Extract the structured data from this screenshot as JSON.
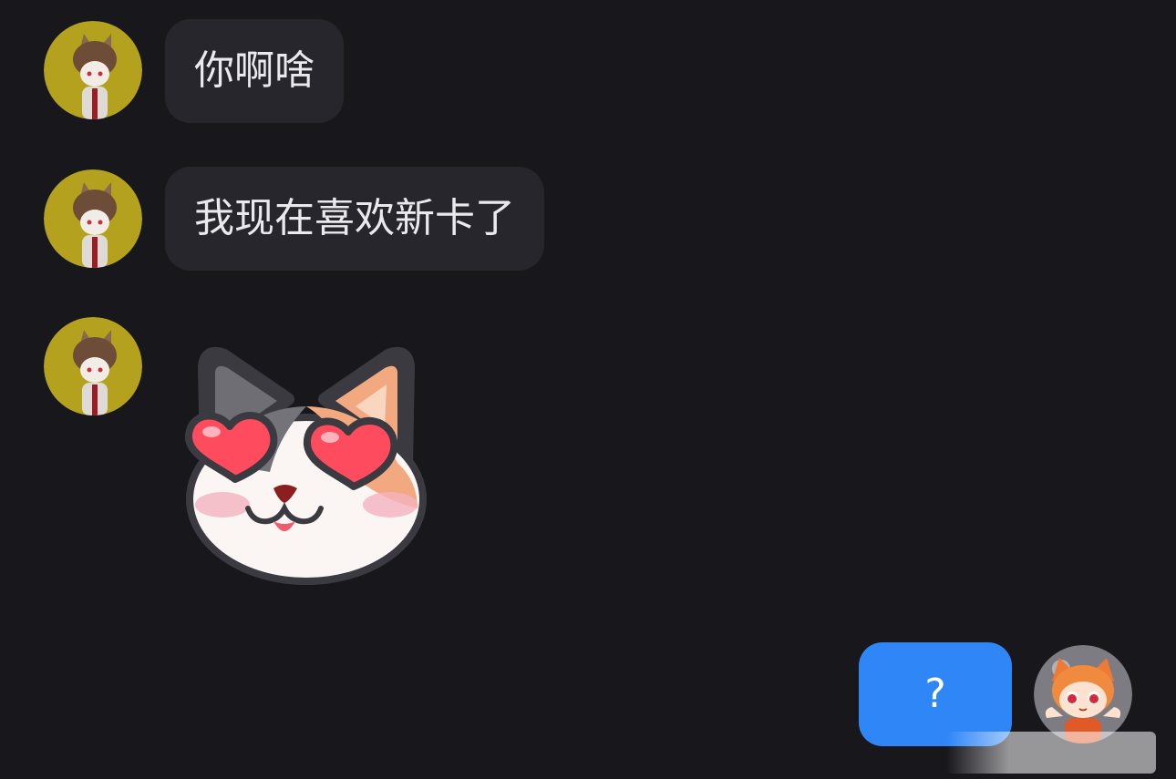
{
  "conversation": {
    "messages": [
      {
        "sender": "other",
        "type": "text",
        "text": "你啊啥"
      },
      {
        "sender": "other",
        "type": "text",
        "text": "我现在喜欢新卡了"
      },
      {
        "sender": "other",
        "type": "sticker",
        "sticker": "cat-heart-eyes-sticker"
      },
      {
        "sender": "me",
        "type": "text",
        "text": "?"
      }
    ]
  },
  "colors": {
    "background": "#18171c",
    "incoming_bubble": "#27262c",
    "outgoing_bubble": "#2f86f7",
    "other_avatar_bg": "#b4a21e"
  }
}
